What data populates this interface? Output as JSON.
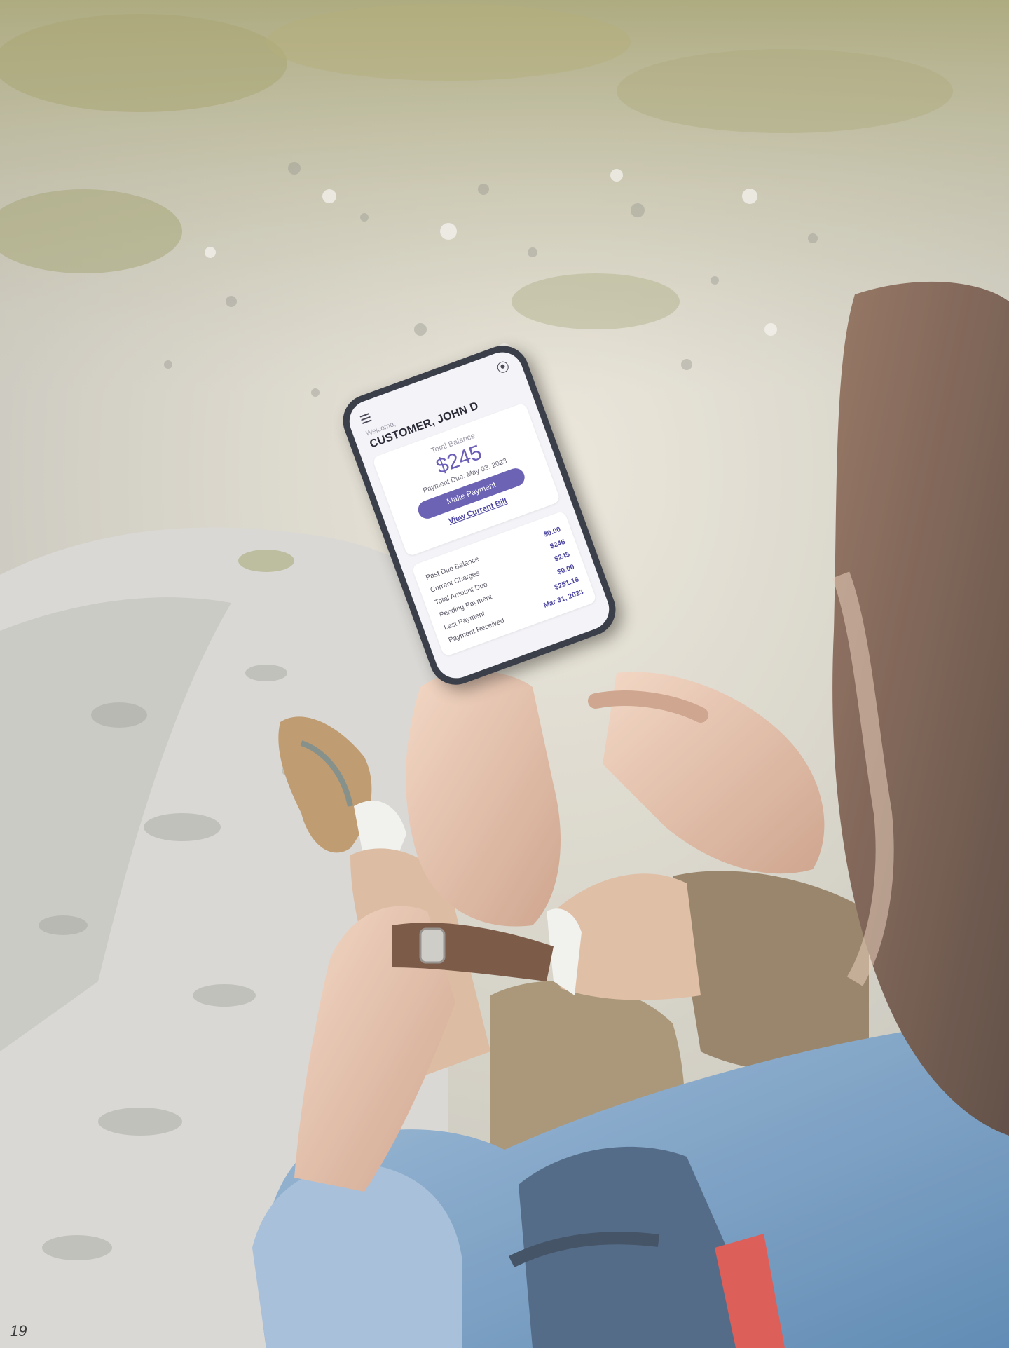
{
  "page_number": "19",
  "app": {
    "welcome": "Welcome,",
    "customer_name": "CUSTOMER, JOHN D",
    "total_balance_label": "Total Balance",
    "total_balance": "$245",
    "payment_due": "Payment Due: May 03, 2023",
    "make_payment": "Make Payment",
    "view_bill": "View Current Bill",
    "rows": [
      {
        "label": "Past Due Balance",
        "value": "$0.00"
      },
      {
        "label": "Current Charges",
        "value": "$245"
      },
      {
        "label": "Total Amount Due",
        "value": "$245"
      },
      {
        "label": "Pending Payment",
        "value": "$0.00"
      },
      {
        "label": "Last Payment",
        "value": "$251.16"
      },
      {
        "label": "Payment Received",
        "value": "Mar 31, 2023"
      }
    ],
    "accent_color": "#6c63b5"
  }
}
